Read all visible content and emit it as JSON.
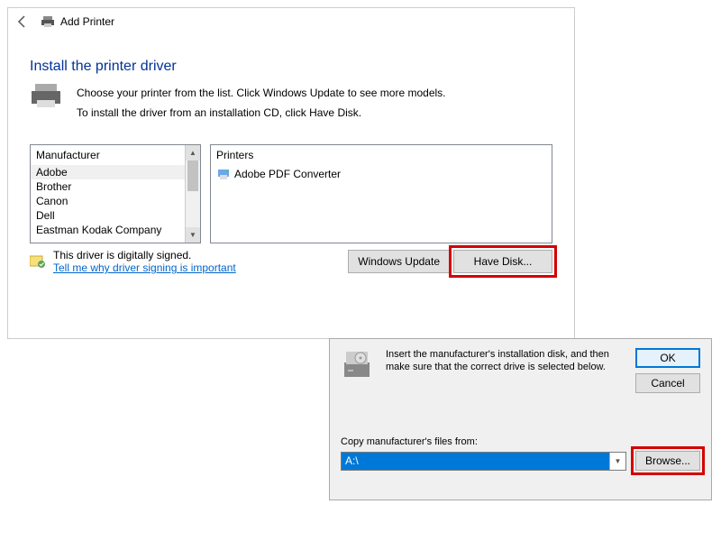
{
  "titlebar": {
    "title": "Add Printer"
  },
  "heading": "Install the printer driver",
  "instructions": {
    "line1": "Choose your printer from the list. Click Windows Update to see more models.",
    "line2": "To install the driver from an installation CD, click Have Disk."
  },
  "lists": {
    "mfg_header": "Manufacturer",
    "mfg_items": [
      "Adobe",
      "Brother",
      "Canon",
      "Dell",
      "Eastman Kodak Company"
    ],
    "prn_header": "Printers",
    "prn_items": [
      "Adobe PDF Converter"
    ]
  },
  "signing": {
    "status": "This driver is digitally signed.",
    "link": "Tell me why driver signing is important"
  },
  "buttons": {
    "windows_update": "Windows Update",
    "have_disk": "Have Disk..."
  },
  "disk_dialog": {
    "text": "Insert the manufacturer's installation disk, and then make sure that the correct drive is selected below.",
    "ok": "OK",
    "cancel": "Cancel",
    "copy_label": "Copy manufacturer's files from:",
    "path": "A:\\",
    "browse": "Browse..."
  }
}
